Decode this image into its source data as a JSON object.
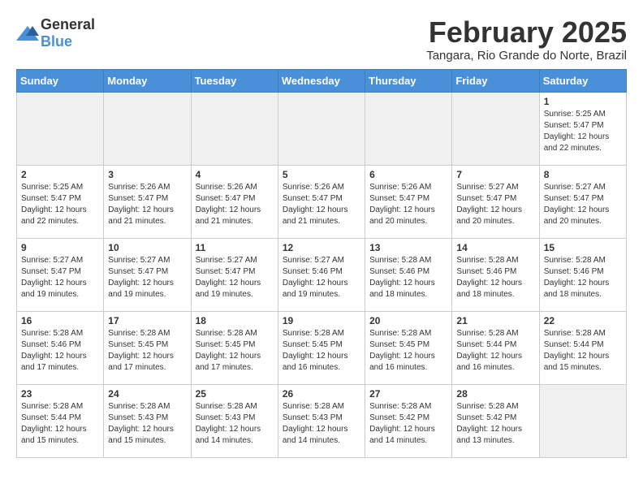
{
  "logo": {
    "general": "General",
    "blue": "Blue"
  },
  "header": {
    "month": "February 2025",
    "location": "Tangara, Rio Grande do Norte, Brazil"
  },
  "weekdays": [
    "Sunday",
    "Monday",
    "Tuesday",
    "Wednesday",
    "Thursday",
    "Friday",
    "Saturday"
  ],
  "weeks": [
    [
      {
        "day": "",
        "info": ""
      },
      {
        "day": "",
        "info": ""
      },
      {
        "day": "",
        "info": ""
      },
      {
        "day": "",
        "info": ""
      },
      {
        "day": "",
        "info": ""
      },
      {
        "day": "",
        "info": ""
      },
      {
        "day": "1",
        "info": "Sunrise: 5:25 AM\nSunset: 5:47 PM\nDaylight: 12 hours\nand 22 minutes."
      }
    ],
    [
      {
        "day": "2",
        "info": "Sunrise: 5:25 AM\nSunset: 5:47 PM\nDaylight: 12 hours\nand 22 minutes."
      },
      {
        "day": "3",
        "info": "Sunrise: 5:26 AM\nSunset: 5:47 PM\nDaylight: 12 hours\nand 21 minutes."
      },
      {
        "day": "4",
        "info": "Sunrise: 5:26 AM\nSunset: 5:47 PM\nDaylight: 12 hours\nand 21 minutes."
      },
      {
        "day": "5",
        "info": "Sunrise: 5:26 AM\nSunset: 5:47 PM\nDaylight: 12 hours\nand 21 minutes."
      },
      {
        "day": "6",
        "info": "Sunrise: 5:26 AM\nSunset: 5:47 PM\nDaylight: 12 hours\nand 20 minutes."
      },
      {
        "day": "7",
        "info": "Sunrise: 5:27 AM\nSunset: 5:47 PM\nDaylight: 12 hours\nand 20 minutes."
      },
      {
        "day": "8",
        "info": "Sunrise: 5:27 AM\nSunset: 5:47 PM\nDaylight: 12 hours\nand 20 minutes."
      }
    ],
    [
      {
        "day": "9",
        "info": "Sunrise: 5:27 AM\nSunset: 5:47 PM\nDaylight: 12 hours\nand 19 minutes."
      },
      {
        "day": "10",
        "info": "Sunrise: 5:27 AM\nSunset: 5:47 PM\nDaylight: 12 hours\nand 19 minutes."
      },
      {
        "day": "11",
        "info": "Sunrise: 5:27 AM\nSunset: 5:47 PM\nDaylight: 12 hours\nand 19 minutes."
      },
      {
        "day": "12",
        "info": "Sunrise: 5:27 AM\nSunset: 5:46 PM\nDaylight: 12 hours\nand 19 minutes."
      },
      {
        "day": "13",
        "info": "Sunrise: 5:28 AM\nSunset: 5:46 PM\nDaylight: 12 hours\nand 18 minutes."
      },
      {
        "day": "14",
        "info": "Sunrise: 5:28 AM\nSunset: 5:46 PM\nDaylight: 12 hours\nand 18 minutes."
      },
      {
        "day": "15",
        "info": "Sunrise: 5:28 AM\nSunset: 5:46 PM\nDaylight: 12 hours\nand 18 minutes."
      }
    ],
    [
      {
        "day": "16",
        "info": "Sunrise: 5:28 AM\nSunset: 5:46 PM\nDaylight: 12 hours\nand 17 minutes."
      },
      {
        "day": "17",
        "info": "Sunrise: 5:28 AM\nSunset: 5:45 PM\nDaylight: 12 hours\nand 17 minutes."
      },
      {
        "day": "18",
        "info": "Sunrise: 5:28 AM\nSunset: 5:45 PM\nDaylight: 12 hours\nand 17 minutes."
      },
      {
        "day": "19",
        "info": "Sunrise: 5:28 AM\nSunset: 5:45 PM\nDaylight: 12 hours\nand 16 minutes."
      },
      {
        "day": "20",
        "info": "Sunrise: 5:28 AM\nSunset: 5:45 PM\nDaylight: 12 hours\nand 16 minutes."
      },
      {
        "day": "21",
        "info": "Sunrise: 5:28 AM\nSunset: 5:44 PM\nDaylight: 12 hours\nand 16 minutes."
      },
      {
        "day": "22",
        "info": "Sunrise: 5:28 AM\nSunset: 5:44 PM\nDaylight: 12 hours\nand 15 minutes."
      }
    ],
    [
      {
        "day": "23",
        "info": "Sunrise: 5:28 AM\nSunset: 5:44 PM\nDaylight: 12 hours\nand 15 minutes."
      },
      {
        "day": "24",
        "info": "Sunrise: 5:28 AM\nSunset: 5:43 PM\nDaylight: 12 hours\nand 15 minutes."
      },
      {
        "day": "25",
        "info": "Sunrise: 5:28 AM\nSunset: 5:43 PM\nDaylight: 12 hours\nand 14 minutes."
      },
      {
        "day": "26",
        "info": "Sunrise: 5:28 AM\nSunset: 5:43 PM\nDaylight: 12 hours\nand 14 minutes."
      },
      {
        "day": "27",
        "info": "Sunrise: 5:28 AM\nSunset: 5:42 PM\nDaylight: 12 hours\nand 14 minutes."
      },
      {
        "day": "28",
        "info": "Sunrise: 5:28 AM\nSunset: 5:42 PM\nDaylight: 12 hours\nand 13 minutes."
      },
      {
        "day": "",
        "info": ""
      }
    ]
  ]
}
